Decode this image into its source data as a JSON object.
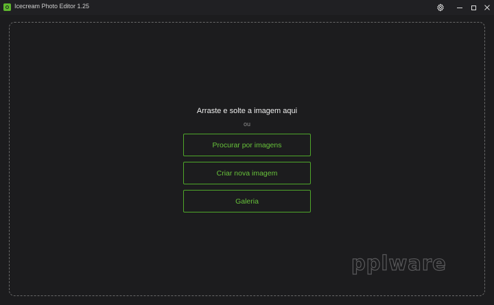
{
  "window": {
    "title": "Icecream Photo Editor 1.25",
    "icons": {
      "app": "app-camera-icon",
      "settings": "gear-icon",
      "minimize": "minimize-icon",
      "maximize": "maximize-icon",
      "close": "close-icon"
    },
    "close_glyph": "✕"
  },
  "dropzone": {
    "title": "Arraste e solte a imagem aqui",
    "or_text": "ou",
    "buttons": [
      {
        "label": "Procurar por imagens"
      },
      {
        "label": "Criar nova imagem"
      },
      {
        "label": "Galeria"
      }
    ]
  },
  "watermark": {
    "text": "pplware"
  },
  "colors": {
    "background": "#1c1c1e",
    "titlebar": "#202023",
    "accent": "#5fb82e",
    "button_text": "#67c23a",
    "dash": "#6a6a6a"
  }
}
